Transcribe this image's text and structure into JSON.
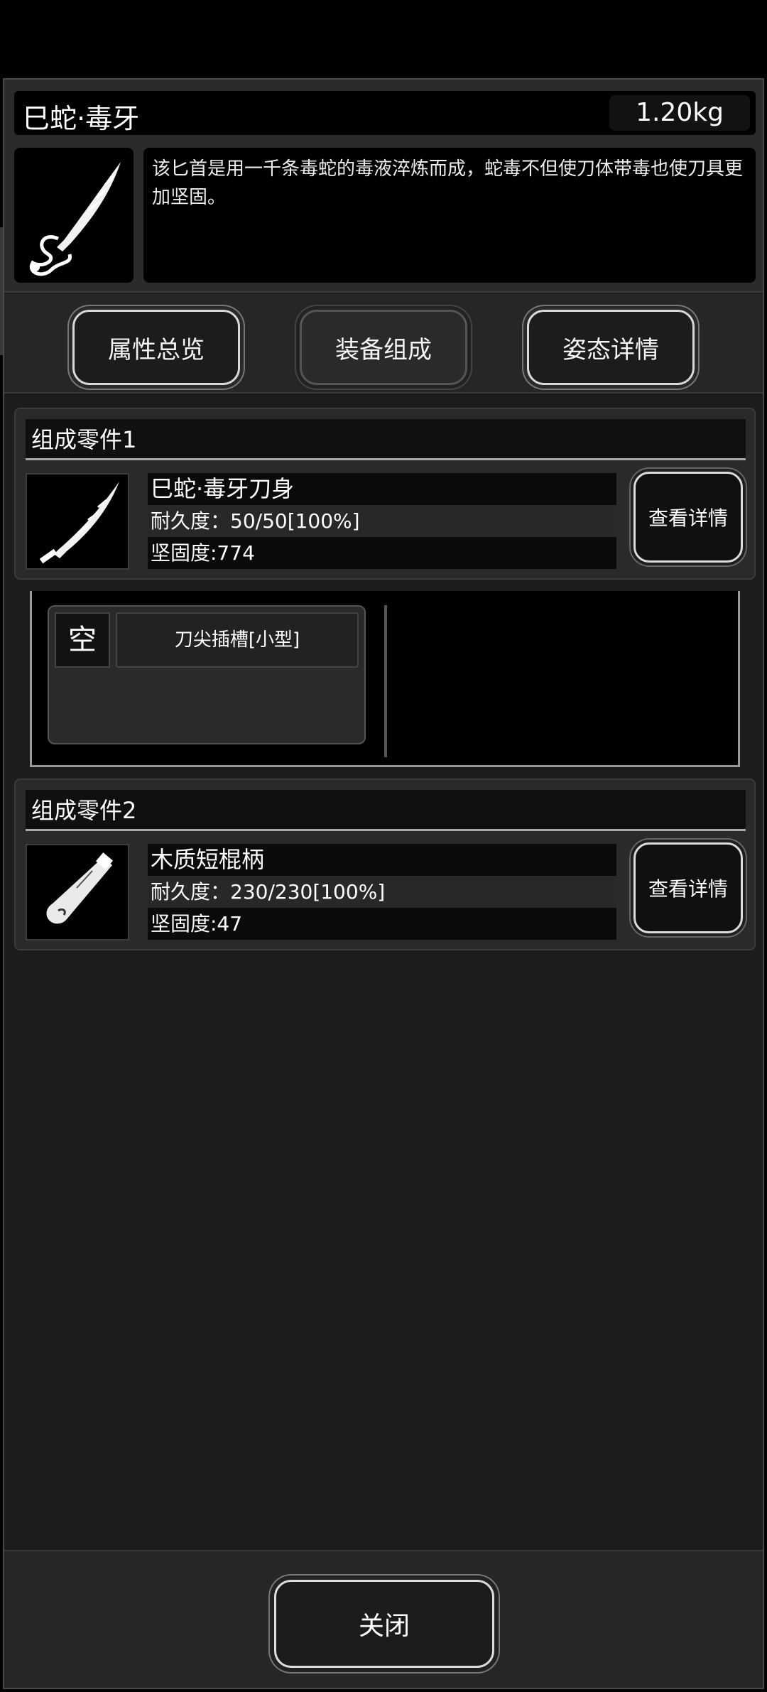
{
  "item": {
    "name": "巳蛇·毒牙",
    "weight": "1.20kg",
    "description": "该匕首是用一千条毒蛇的毒液淬炼而成，蛇毒不但使刀体带毒也使刀具更加坚固。",
    "icon": "serpent-dagger-icon"
  },
  "tabs": [
    {
      "label": "属性总览"
    },
    {
      "label": "装备组成"
    },
    {
      "label": "姿态详情"
    }
  ],
  "components": [
    {
      "title": "组成零件1",
      "name": "巳蛇·毒牙刀身",
      "durability": "耐久度：50/50[100%]",
      "hardness": "坚固度:774",
      "button": "查看详情",
      "icon": "blade-icon"
    },
    {
      "title": "组成零件2",
      "name": "木质短棍柄",
      "durability": "耐久度：230/230[100%]",
      "hardness": "坚固度:47",
      "button": "查看详情",
      "icon": "wooden-handle-icon"
    }
  ],
  "slot": {
    "empty_label": "空",
    "name": "刀尖插槽[小型]"
  },
  "close_button": "关闭"
}
